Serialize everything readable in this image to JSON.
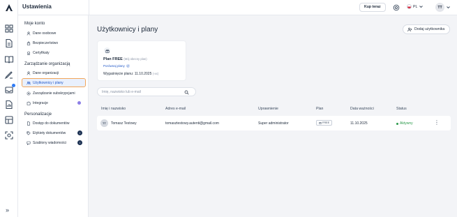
{
  "app": {
    "title": "Ustawienia"
  },
  "topbar": {
    "buy_label": "Kup teraz",
    "language": "PL",
    "user_initials": "TT"
  },
  "sidebar": {
    "sections": [
      {
        "title": "Moje konto",
        "items": [
          {
            "label": "Dane osobowe",
            "icon": "user-icon"
          },
          {
            "label": "Bezpieczeństwo",
            "icon": "lock-icon"
          },
          {
            "label": "Certyfikaty",
            "icon": "certificate-icon"
          }
        ]
      },
      {
        "title": "Zarządzanie organizacją",
        "items": [
          {
            "label": "Dane organizacji",
            "icon": "user-icon"
          },
          {
            "label": "Użytkownicy i plany",
            "icon": "users-icon",
            "active": true
          },
          {
            "label": "Zarządzanie subskrypcjami",
            "icon": "gear-icon"
          },
          {
            "label": "Integracje",
            "icon": "puzzle-icon"
          }
        ]
      },
      {
        "title": "Personalizacje",
        "items": [
          {
            "label": "Dostęp do dokumentów",
            "icon": "document-icon"
          },
          {
            "label": "Etykiety dokumentów",
            "icon": "tag-icon",
            "badge": "i"
          },
          {
            "label": "Szablony wiadomości",
            "icon": "message-icon",
            "badge": "i"
          }
        ]
      }
    ]
  },
  "main": {
    "title": "Użytkownicy i plany",
    "add_user_label": "Dodaj użytkownika",
    "plan": {
      "name": "Plan FREE",
      "subtitle": "(Mój obecny plan)",
      "compare_label": "Porównaj plany",
      "expiry_label": "Wygaśnięcie planu: 11.10.2025",
      "expiry_note": "(-xx)"
    },
    "search": {
      "placeholder": "Imię, nazwisko lub e-mail",
      "value": ""
    },
    "table": {
      "headers": [
        "Imię i nazwisko",
        "Adres e-mail",
        "Uprawnienie",
        "Plan",
        "Data ważności",
        "Status"
      ],
      "rows": [
        {
          "initials": "TT",
          "name": "Tomasz Testowy",
          "email": "tomasztestowy.autenti@gmail.com",
          "role": "Super administrator",
          "plan": "FREE",
          "expiry": "11.10.2025",
          "status": "Aktywny"
        }
      ]
    }
  },
  "colors": {
    "accent": "#2158c7",
    "active_status": "#2c9a4b",
    "highlight_outline": "#f2a65a"
  }
}
